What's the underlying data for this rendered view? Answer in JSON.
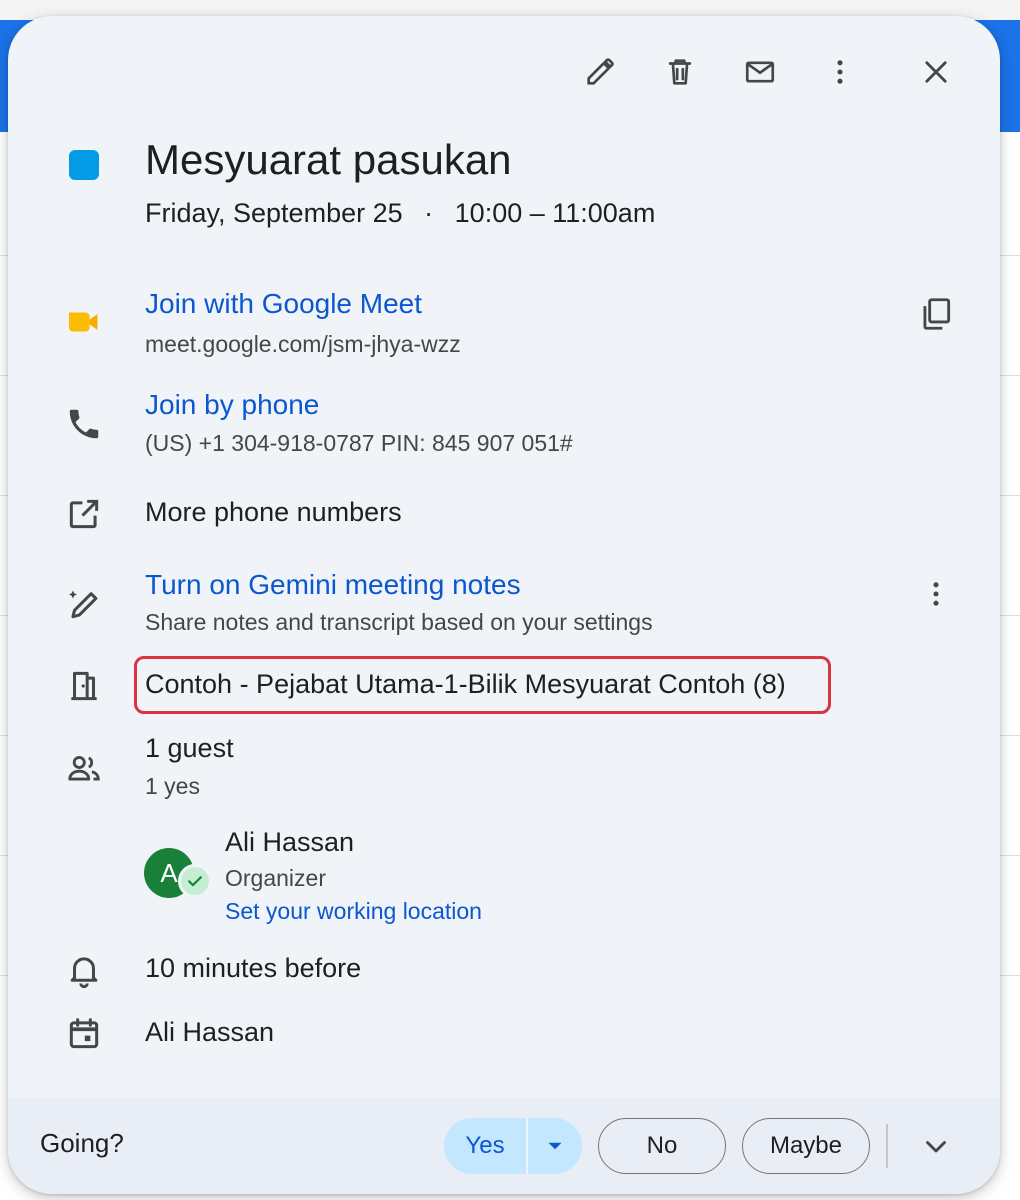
{
  "event": {
    "title": "Mesyuarat pasukan",
    "date": "Friday, September 25",
    "separator": "·",
    "time": "10:00 – 11:00am",
    "color": "#039be5"
  },
  "meet": {
    "label": "Join with Google Meet",
    "url": "meet.google.com/jsm-jhya-wzz"
  },
  "phone": {
    "label": "Join by phone",
    "details": "(US) +1 304-918-0787 PIN: 845 907 051#"
  },
  "more_phones": "More phone numbers",
  "gemini": {
    "label": "Turn on Gemini meeting notes",
    "sub": "Share notes and transcript based on your settings"
  },
  "room": "Contoh - Pejabat Utama-1-Bilik Mesyuarat Contoh (8)",
  "guests": {
    "count": "1 guest",
    "summary": "1 yes",
    "list": [
      {
        "initial": "A",
        "name": "Ali Hassan",
        "role": "Organizer",
        "action": "Set your working location"
      }
    ]
  },
  "reminder": "10 minutes before",
  "calendar_owner": "Ali Hassan",
  "rsvp": {
    "prompt": "Going?",
    "yes": "Yes",
    "no": "No",
    "maybe": "Maybe"
  }
}
